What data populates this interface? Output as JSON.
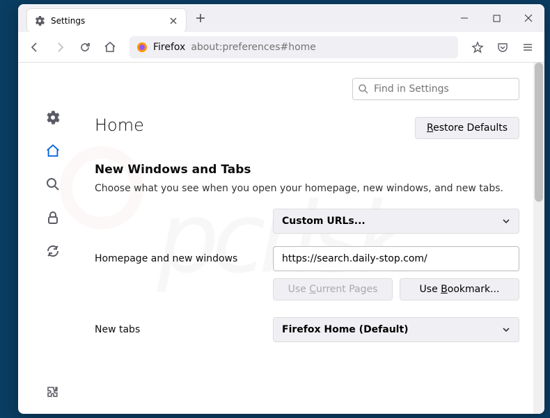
{
  "tab": {
    "title": "Settings"
  },
  "urlbar": {
    "prefix": "Firefox",
    "url": "about:preferences#home"
  },
  "search": {
    "placeholder": "Find in Settings"
  },
  "page": {
    "heading": "Home",
    "restore_label": "Restore Defaults",
    "section_title": "New Windows and Tabs",
    "section_desc": "Choose what you see when you open your homepage, new windows, and new tabs.",
    "homepage_label": "Homepage and new windows",
    "homepage_select": "Custom URLs...",
    "homepage_url": "https://search.daily-stop.com/",
    "use_current": "Use Current Pages",
    "use_bookmark": "Use Bookmark...",
    "newtabs_label": "New tabs",
    "newtabs_select": "Firefox Home (Default)"
  }
}
